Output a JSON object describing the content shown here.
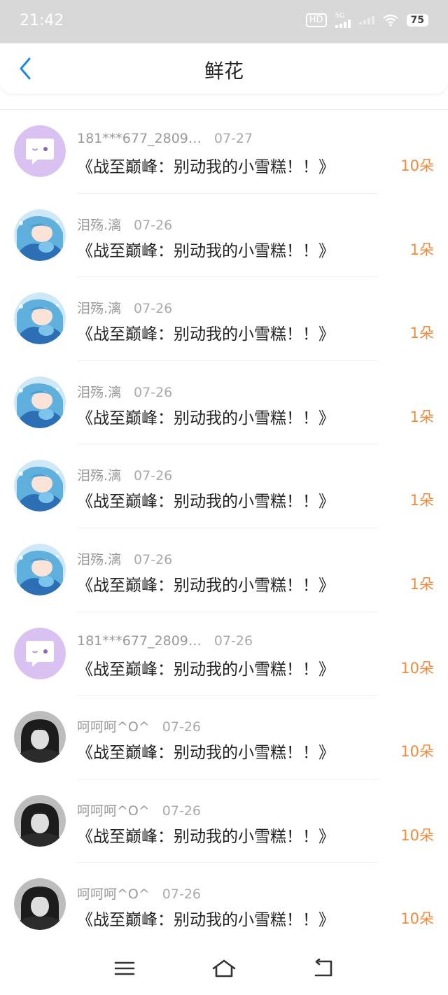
{
  "status_bar": {
    "time": "21:42",
    "network_hd": "HD",
    "network_5g": "5G",
    "battery": "75"
  },
  "header": {
    "title": "鲜花",
    "back_icon": "chevron-left-icon"
  },
  "colors": {
    "accent": "#1e88e5",
    "amount": "#f08a3c",
    "default_avatar": "#d9c2f2"
  },
  "rows": [
    {
      "user": "181***677_2809…",
      "date": "07-27",
      "title": "《战至巅峰：别动我的小雪糕！！》",
      "amount": "10朵",
      "avatar": "default"
    },
    {
      "user": "泪殇.漓",
      "date": "07-26",
      "title": "《战至巅峰：别动我的小雪糕！！》",
      "amount": "1朵",
      "avatar": "anime"
    },
    {
      "user": "泪殇.漓",
      "date": "07-26",
      "title": "《战至巅峰：别动我的小雪糕！！》",
      "amount": "1朵",
      "avatar": "anime"
    },
    {
      "user": "泪殇.漓",
      "date": "07-26",
      "title": "《战至巅峰：别动我的小雪糕！！》",
      "amount": "1朵",
      "avatar": "anime"
    },
    {
      "user": "泪殇.漓",
      "date": "07-26",
      "title": "《战至巅峰：别动我的小雪糕！！》",
      "amount": "1朵",
      "avatar": "anime"
    },
    {
      "user": "泪殇.漓",
      "date": "07-26",
      "title": "《战至巅峰：别动我的小雪糕！！》",
      "amount": "1朵",
      "avatar": "anime"
    },
    {
      "user": "181***677_2809…",
      "date": "07-26",
      "title": "《战至巅峰：别动我的小雪糕！！》",
      "amount": "10朵",
      "avatar": "default"
    },
    {
      "user": "呵呵呵^O^",
      "date": "07-26",
      "title": "《战至巅峰：别动我的小雪糕！！》",
      "amount": "10朵",
      "avatar": "photo"
    },
    {
      "user": "呵呵呵^O^",
      "date": "07-26",
      "title": "《战至巅峰：别动我的小雪糕！！》",
      "amount": "10朵",
      "avatar": "photo"
    },
    {
      "user": "呵呵呵^O^",
      "date": "07-26",
      "title": "《战至巅峰：别动我的小雪糕！！》",
      "amount": "10朵",
      "avatar": "photo"
    }
  ],
  "bottom_nav": {
    "menu_icon": "menu-icon",
    "home_icon": "home-icon",
    "back_icon": "back-icon"
  }
}
